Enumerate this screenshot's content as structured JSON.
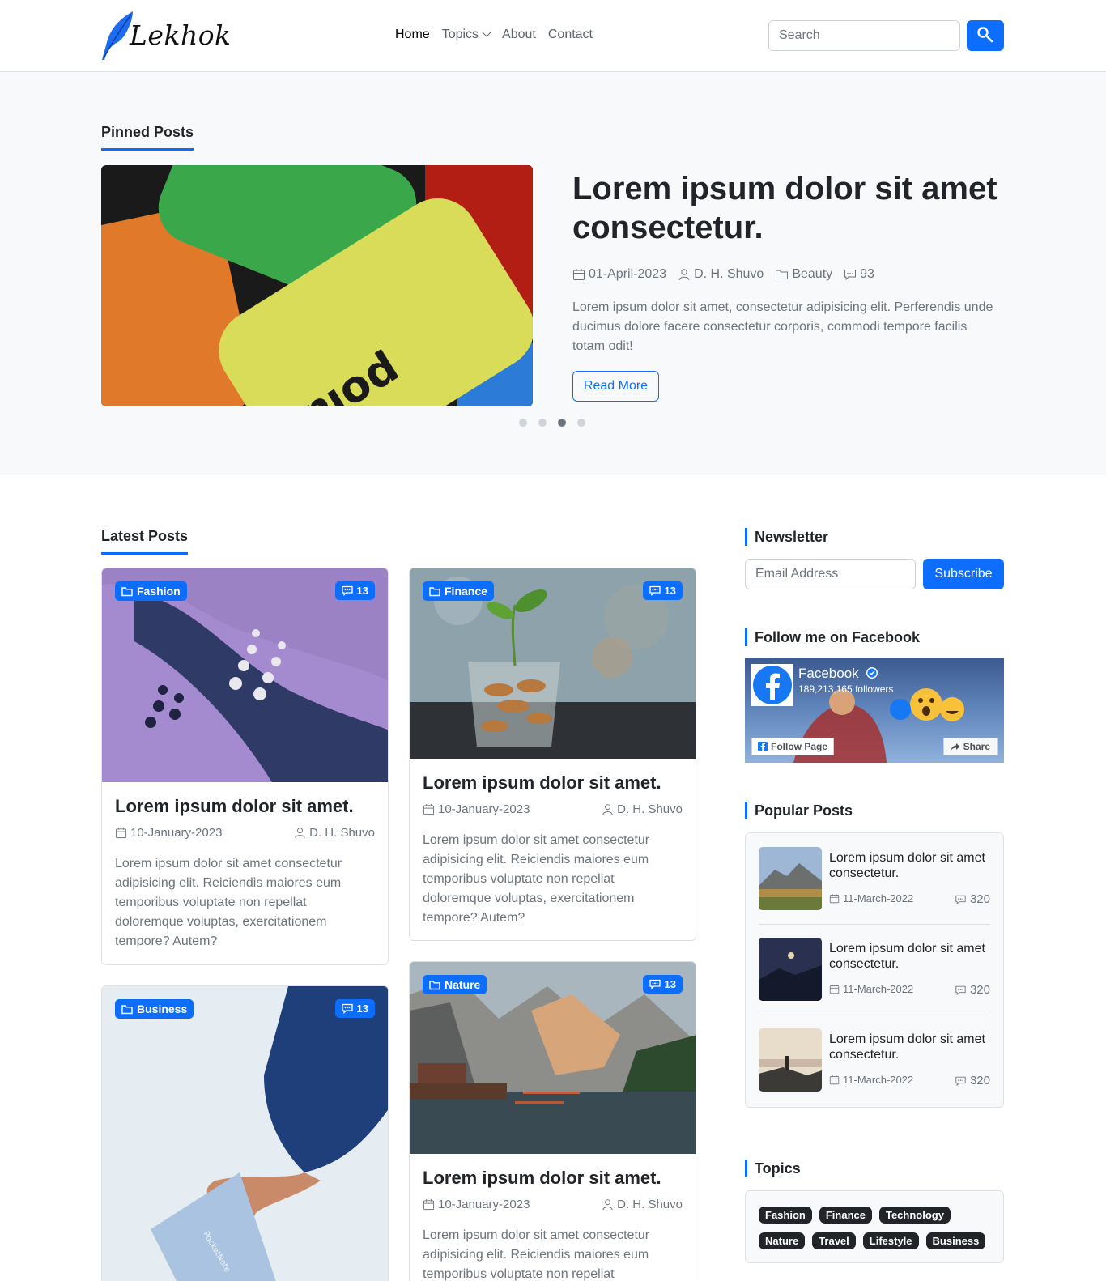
{
  "header": {
    "logo_text": "Lekhok",
    "nav": [
      {
        "label": "Home"
      },
      {
        "label": "Topics"
      },
      {
        "label": "About"
      },
      {
        "label": "Contact"
      }
    ],
    "search_placeholder": "Search"
  },
  "pinned": {
    "section_title": "Pinned Posts",
    "title": "Lorem ipsum dolor sit amet consectetur.",
    "date": "01-April-2023",
    "author": "D. H. Shuvo",
    "category": "Beauty",
    "comments": "93",
    "excerpt": "Lorem ipsum dolor sit amet, consectetur adipisicing elit. Perferendis unde ducimus dolore facere consectetur corporis, commodi tempore facilis totam odit!",
    "read_more": "Read More",
    "carousel_active_index": 2,
    "carousel_count": 4
  },
  "latest": {
    "section_title": "Latest Posts",
    "posts": [
      {
        "category": "Fashion",
        "comments": "13",
        "title": "Lorem ipsum dolor sit amet.",
        "date": "10-January-2023",
        "author": "D. H. Shuvo",
        "excerpt": "Lorem ipsum dolor sit amet consectetur adipisicing elit. Reiciendis maiores eum temporibus voluptate non repellat doloremque voluptas, exercitationem tempore? Autem?"
      },
      {
        "category": "Finance",
        "comments": "13",
        "title": "Lorem ipsum dolor sit amet.",
        "date": "10-January-2023",
        "author": "D. H. Shuvo",
        "excerpt": "Lorem ipsum dolor sit amet consectetur adipisicing elit. Reiciendis maiores eum temporibus voluptate non repellat doloremque voluptas, exercitationem tempore? Autem?"
      },
      {
        "category": "Business",
        "comments": "13"
      },
      {
        "category": "Nature",
        "comments": "13",
        "title": "Lorem ipsum dolor sit amet.",
        "date": "10-January-2023",
        "author": "D. H. Shuvo",
        "excerpt": "Lorem ipsum dolor sit amet consectetur adipisicing elit. Reiciendis maiores eum temporibus voluptate non repellat"
      }
    ]
  },
  "sidebar": {
    "newsletter": {
      "title": "Newsletter",
      "email_placeholder": "Email Address",
      "button": "Subscribe"
    },
    "facebook": {
      "title": "Follow me on Facebook",
      "page_name": "Facebook",
      "followers": "189,213,165 followers",
      "follow_label": "Follow Page",
      "share_label": "Share"
    },
    "popular": {
      "title": "Popular Posts",
      "items": [
        {
          "title": "Lorem ipsum dolor sit amet consectetur.",
          "date": "11-March-2022",
          "comments": "320"
        },
        {
          "title": "Lorem ipsum dolor sit amet consectetur.",
          "date": "11-March-2022",
          "comments": "320"
        },
        {
          "title": "Lorem ipsum dolor sit amet consectetur.",
          "date": "11-March-2022",
          "comments": "320"
        }
      ]
    },
    "topics": {
      "title": "Topics",
      "row1": [
        "Fashion",
        "Finance",
        "Technology"
      ],
      "row2": [
        "Nature",
        "Travel",
        "Lifestyle",
        "Business"
      ]
    }
  },
  "colors": {
    "accent": "#0d6efd",
    "text": "#212529",
    "muted": "#6c757d",
    "tag_dark": "#212529"
  }
}
